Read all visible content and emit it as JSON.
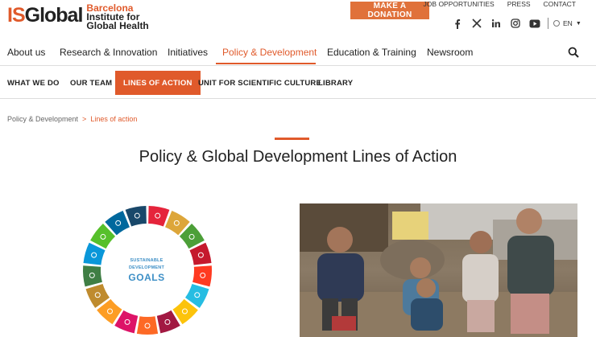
{
  "header": {
    "logo_mark_is": "IS",
    "logo_mark_global": "Global",
    "logo_line1": "Barcelona",
    "logo_line2": "Institute for",
    "logo_line3": "Global Health",
    "donate_label": "MAKE A DONATION",
    "top_links": [
      "JOB OPPORTUNITIES",
      "PRESS",
      "CONTACT"
    ],
    "social_icons": [
      "facebook-icon",
      "x-icon",
      "linkedin-icon",
      "instagram-icon",
      "youtube-icon"
    ],
    "language": "EN"
  },
  "main_nav": {
    "items": [
      "About us",
      "Research & Innovation",
      "Initiatives",
      "Policy & Development",
      "Education & Training",
      "Newsroom"
    ],
    "active_index": 3
  },
  "sub_nav": {
    "items": [
      "WHAT WE DO",
      "OUR TEAM",
      "LINES OF ACTION",
      "UNIT FOR SCIENTIFIC CULTURE",
      "LIBRARY"
    ],
    "active_index": 2
  },
  "breadcrumb": {
    "parent": "Policy & Development",
    "separator": ">",
    "current": "Lines of action"
  },
  "page": {
    "title": "Policy & Global Development Lines of Action"
  },
  "sdg": {
    "line1": "SUSTAINABLE",
    "line2": "DEVELOPMENT",
    "line3": "GOALS",
    "colors": [
      "#e5243b",
      "#dda63a",
      "#4c9f38",
      "#c5192d",
      "#ff3a21",
      "#26bde2",
      "#fcc30b",
      "#a21942",
      "#fd6925",
      "#dd1367",
      "#fd9d24",
      "#bf8b2e",
      "#3f7e44",
      "#0a97d9",
      "#56c02b",
      "#00689d",
      "#19486a"
    ]
  },
  "colors": {
    "accent": "#e05a2b",
    "donate": "#e0713a"
  }
}
